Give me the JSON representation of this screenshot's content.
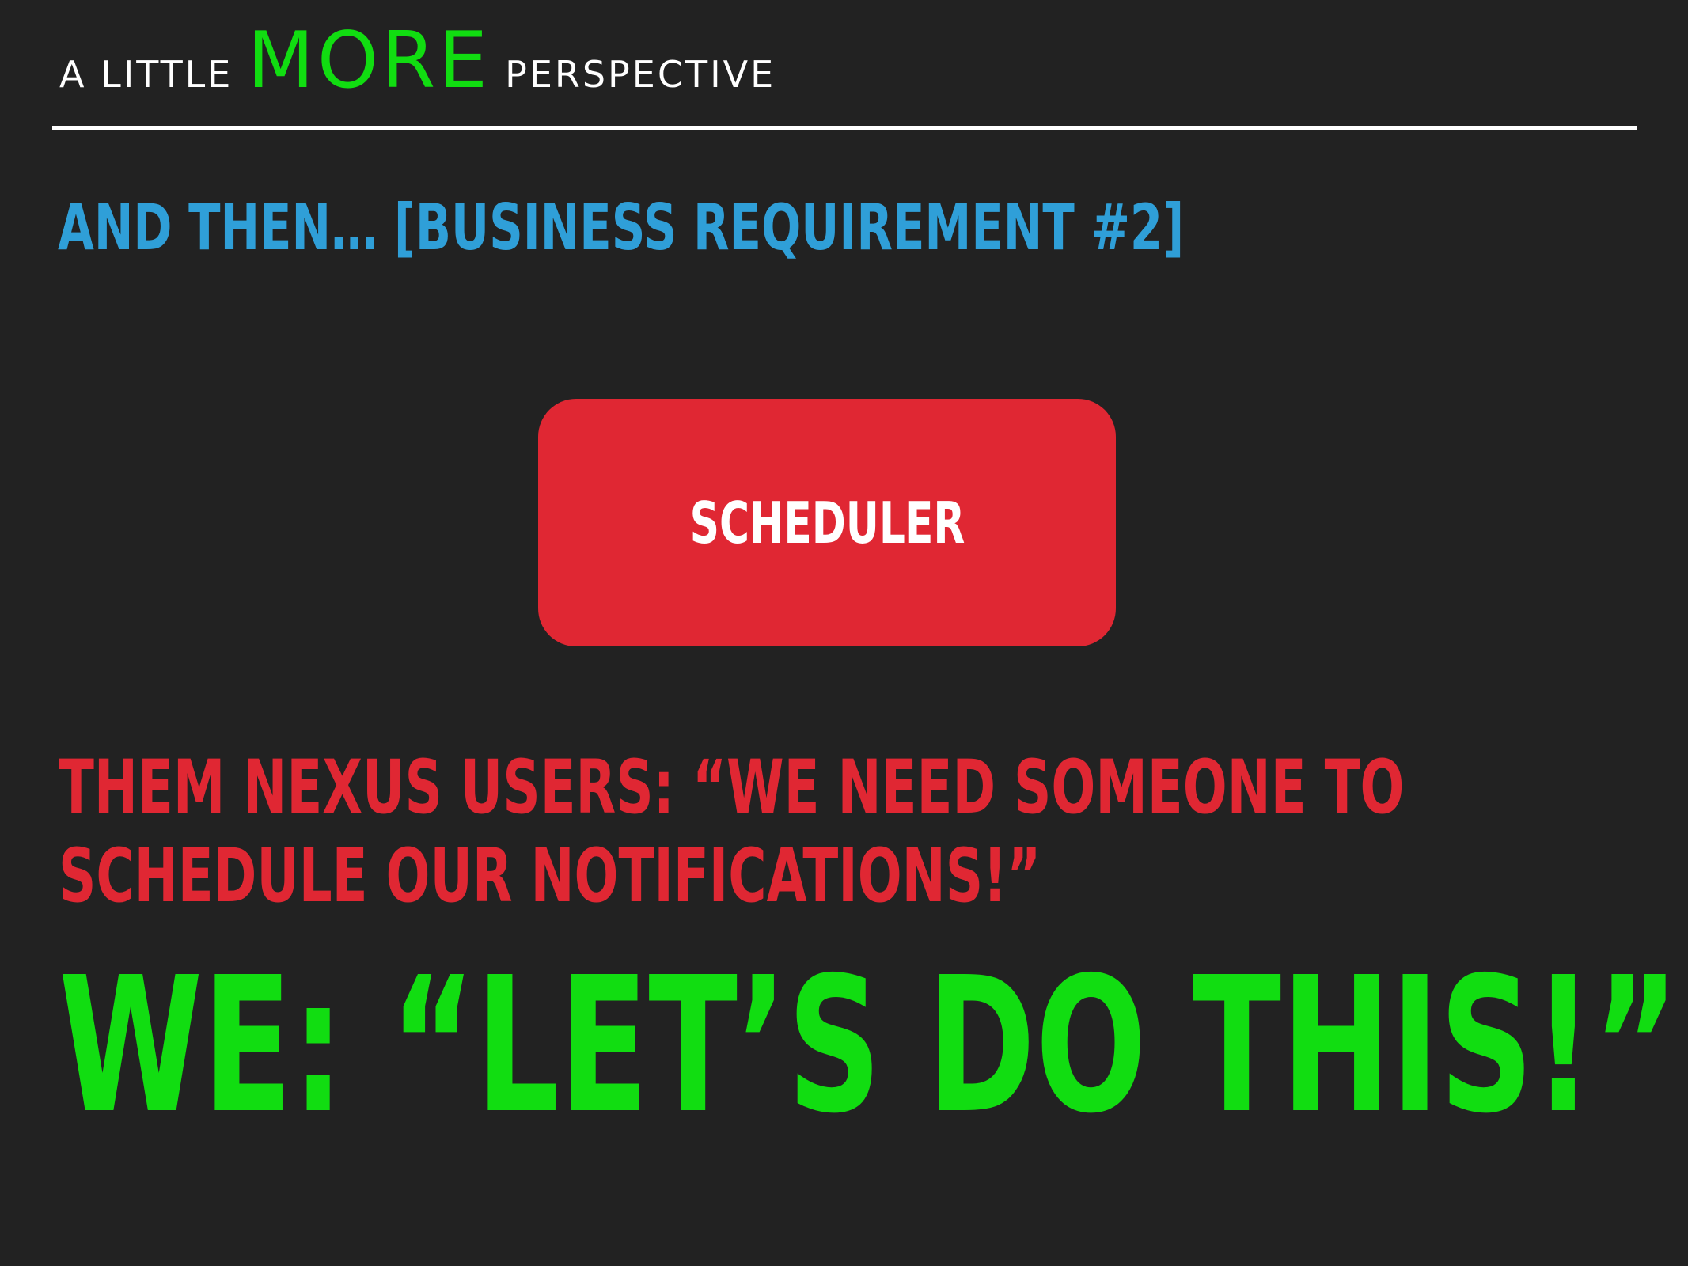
{
  "header": {
    "prefix": "A LITTLE",
    "highlight": "MORE",
    "suffix": "PERSPECTIVE"
  },
  "subtitle": "AND THEN… [BUSINESS REQUIREMENT #2]",
  "diagram": {
    "box_label": "SCHEDULER"
  },
  "quotes": {
    "them": "THEM NEXUS USERS: “WE NEED SOMEONE TO SCHEDULE OUR NOTIFICATIONS!”",
    "we": "WE: “LET’S DO THIS!”"
  },
  "colors": {
    "background": "#222222",
    "white": "#ffffff",
    "green": "#11dd11",
    "blue": "#2f9fd8",
    "red": "#e02733"
  }
}
